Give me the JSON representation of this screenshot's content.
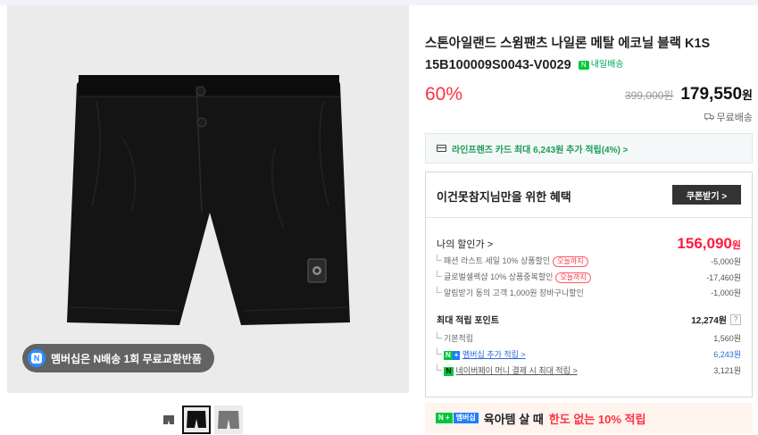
{
  "gallery": {
    "promo_text": "멤버십은 N배송 1회 무료교환반품",
    "thumbnails": [
      "thumb-1",
      "thumb-2",
      "thumb-3"
    ]
  },
  "product": {
    "title": "스톤아일랜드 스윔팬츠 나일론 메탈 에코닐 블랙 K1S 15B100009S0043-V0029",
    "delivery_badge": "내일배송",
    "discount_rate": "60%",
    "original_price": "399,000원",
    "sale_price": "179,550",
    "currency": "원",
    "shipping": "무료배송"
  },
  "card_promo": {
    "text": "라인프렌즈 카드 최대 6,243원 추가 적립(4%) >"
  },
  "benefit": {
    "title": "이건못참지님만을 위한 혜택",
    "coupon_button": "쿠폰받기 >",
    "my_discount_label": "나의 할인가 >",
    "my_discount_value": "156,090",
    "my_discount_unit": "원",
    "discounts": [
      {
        "label": "패션 라스트 세일 10% 상품할인",
        "tag": "오늘까지",
        "value": "-5,000원"
      },
      {
        "label": "글로벌셀렉샵 10% 상품중복할인",
        "tag": "오늘까지",
        "value": "-17,460원"
      },
      {
        "label": "알림받기 동의 고객 1,000원 장바구니할인",
        "tag": "",
        "value": "-1,000원"
      }
    ],
    "points_label": "최대 적립 포인트",
    "points_value": "12,274원",
    "points_help": "?",
    "points": [
      {
        "label": "기본적립",
        "value": "1,560원"
      },
      {
        "label": "멤버십 추가 적립 >",
        "value": "6,243원"
      },
      {
        "label": "네이버페이 머니 결제 시 최대 적립 >",
        "value": "3,121원"
      }
    ]
  },
  "bottom_banner": {
    "logo_n": "N +",
    "logo_m": "멤버십",
    "text_a": "육아템 살 때",
    "text_b": "한도 없는 10% 적립"
  },
  "colors": {
    "accent_red": "#ff3040",
    "naver_green": "#00c73c",
    "link_blue": "#2a6ad6"
  }
}
